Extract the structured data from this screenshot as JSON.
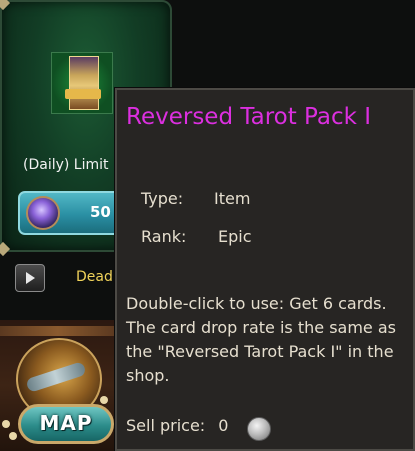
{
  "shop_card": {
    "limit_label": "(Daily) Limit",
    "price": "50",
    "item_badge": "",
    "currency_icon": "purple-gem-icon"
  },
  "hud": {
    "dead_label": "Dead",
    "play_icon": "play-icon",
    "map_label": "MAP"
  },
  "tooltip": {
    "title": "Reversed Tarot Pack I",
    "type_label": "Type:",
    "type_value": "Item",
    "rank_label": "Rank:",
    "rank_value": "Epic",
    "description": "Double-click to use: Get 6 cards. The card drop rate is the same as the \"Reversed Tarot Pack I\" in the shop.",
    "sell_label": "Sell price:",
    "sell_value": "0",
    "sell_icon": "silver-coin-icon"
  },
  "colors": {
    "title": "#dc2fe0",
    "body_text": "#e6dfcf",
    "tooltip_bg": "#272523",
    "dead_label": "#f0d35a"
  }
}
